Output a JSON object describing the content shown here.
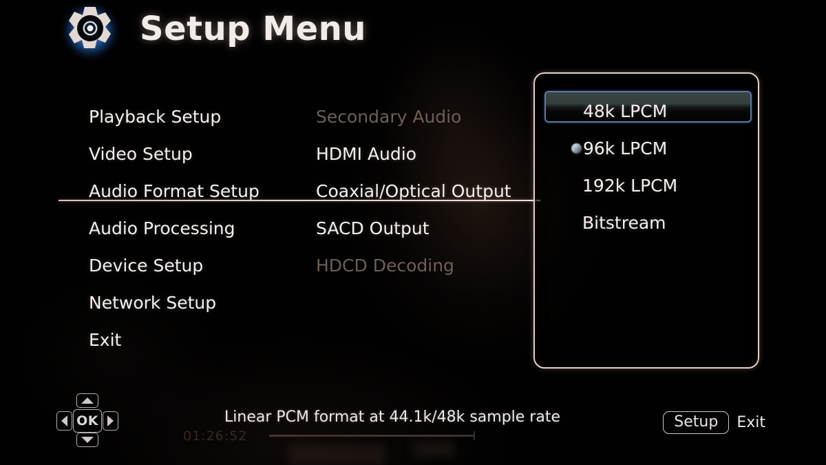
{
  "header": {
    "icon": "gear-icon",
    "title": "Setup Menu"
  },
  "sidebar": {
    "items": [
      {
        "label": "Playback Setup",
        "state": "normal"
      },
      {
        "label": "Video Setup",
        "state": "normal"
      },
      {
        "label": "Audio Format Setup",
        "state": "active"
      },
      {
        "label": "Audio Processing",
        "state": "normal"
      },
      {
        "label": "Device Setup",
        "state": "normal"
      },
      {
        "label": "Network Setup",
        "state": "normal"
      },
      {
        "label": "Exit",
        "state": "normal"
      }
    ]
  },
  "submenu": {
    "items": [
      {
        "label": "Secondary Audio",
        "state": "disabled"
      },
      {
        "label": "HDMI Audio",
        "state": "normal"
      },
      {
        "label": "Coaxial/Optical Output",
        "state": "active"
      },
      {
        "label": "SACD Output",
        "state": "normal"
      },
      {
        "label": "HDCD Decoding",
        "state": "disabled"
      }
    ]
  },
  "options_panel": {
    "options": [
      {
        "label": "48k  LPCM",
        "highlighted": true,
        "selected": false
      },
      {
        "label": "96k  LPCM",
        "highlighted": false,
        "selected": true
      },
      {
        "label": "192k LPCM",
        "highlighted": false,
        "selected": false
      },
      {
        "label": "Bitstream",
        "highlighted": false,
        "selected": false
      }
    ]
  },
  "footer": {
    "hint_text": "Linear PCM format at 44.1k/48k sample rate",
    "dpad": {
      "up": "up-arrow-icon",
      "down": "down-arrow-icon",
      "left": "left-arrow-icon",
      "right": "right-arrow-icon",
      "ok_label": "OK"
    },
    "setup_key_label": "Setup",
    "exit_label": "Exit"
  },
  "background_video": {
    "timecode": "01:26:52"
  },
  "colors": {
    "screen_background": "#010101",
    "text_primary": "#f4efec",
    "text_disabled": "#6e5f57",
    "panel_border": "#e9cfc8",
    "highlight_border": "#5a7ca8",
    "divider": "#e8d6cf",
    "gear_glow": "#4fa8ff"
  }
}
